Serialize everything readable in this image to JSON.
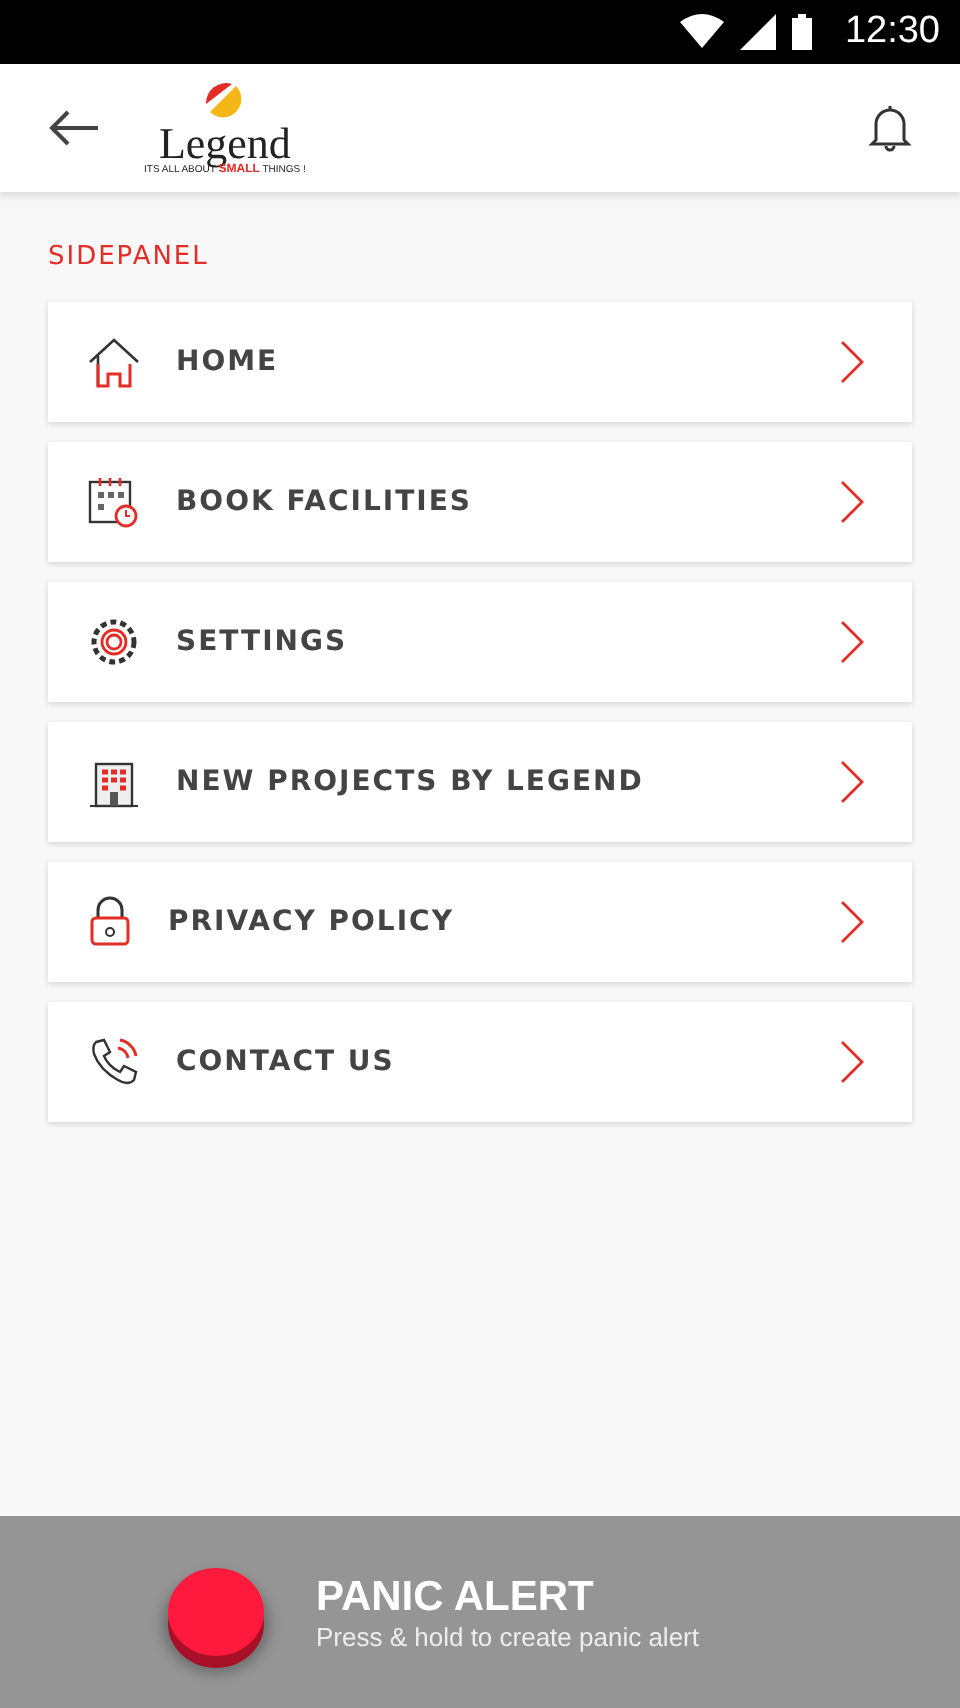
{
  "status_bar": {
    "time": "12:30"
  },
  "header": {
    "logo_word": "Legend",
    "logo_tagline_start": "ITS ALL ABOUT ",
    "logo_tagline_strong": "SMALL",
    "logo_tagline_end": " THINGS !"
  },
  "section_title": "SIDEPANEL",
  "menu": [
    {
      "kind": "home",
      "label": "HOME"
    },
    {
      "kind": "calendar",
      "label": "BOOK FACILITIES"
    },
    {
      "kind": "gear",
      "label": "SETTINGS"
    },
    {
      "kind": "building",
      "label": "NEW PROJECTS BY LEGEND"
    },
    {
      "kind": "lock",
      "label": "PRIVACY POLICY"
    },
    {
      "kind": "phone",
      "label": "CONTACT US"
    }
  ],
  "panic": {
    "title": "PANIC ALERT",
    "subtitle": "Press & hold to create panic alert"
  }
}
